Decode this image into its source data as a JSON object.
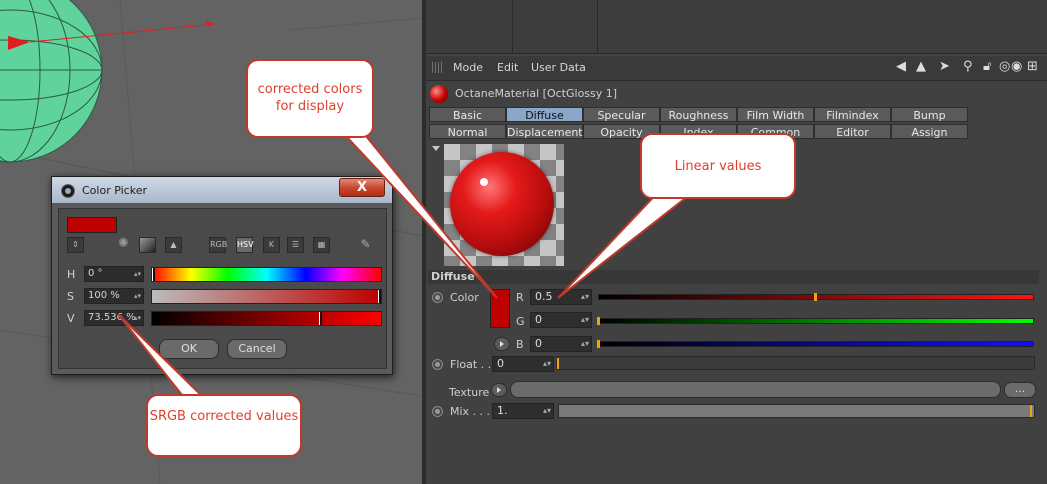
{
  "attribute_manager": {
    "menu": [
      "Mode",
      "Edit",
      "User Data"
    ],
    "material_title": "OctaneMaterial [OctGlossy 1]",
    "tabs_row1": [
      "Basic",
      "Diffuse",
      "Specular",
      "Roughness",
      "Film Width",
      "Filmindex",
      "Bump"
    ],
    "tabs_row2": [
      "Normal",
      "Displacement",
      "Opacity",
      "Index",
      "Common",
      "Editor",
      "Assign"
    ],
    "active_tab": "Diffuse",
    "section_header": "Diffuse",
    "color_label": "Color",
    "color_swatch": "#bd0000",
    "r_label": "R",
    "r_value": "0.5",
    "g_label": "G",
    "g_value": "0",
    "b_label": "B",
    "b_value": "0",
    "float_label": "Float . .",
    "float_value": "0",
    "texture_label": "Texture",
    "texture_more": "...",
    "mix_label": "Mix . . .",
    "mix_value": "1."
  },
  "color_picker": {
    "title": "Color Picker",
    "close_label": "X",
    "swatch_color": "#bd0000",
    "modes": [
      "RGB",
      "HSV",
      "K"
    ],
    "active_mode": "HSV",
    "h_label": "H",
    "h_value": "0 °",
    "s_label": "S",
    "s_value": "100 %",
    "v_label": "V",
    "v_value": "73.536 %",
    "ok_label": "OK",
    "cancel_label": "Cancel"
  },
  "callouts": {
    "display": "corrected colors for display",
    "linear": "Linear values",
    "srgb": "SRGB corrected values"
  },
  "colors": {
    "callout_border": "#c0392b",
    "callout_text": "#e0402f",
    "active_tab": "#8aa6c9",
    "slider_marker": "#f4a10f"
  }
}
